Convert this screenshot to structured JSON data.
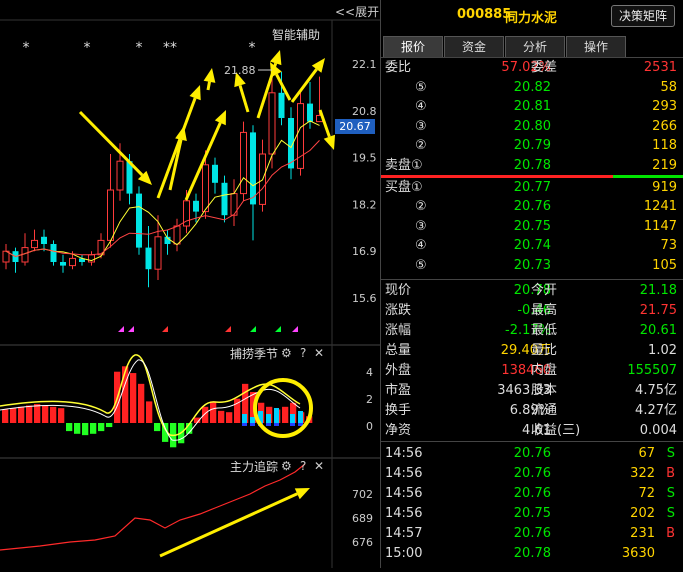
{
  "chart": {
    "toggle_label": "<<展开",
    "indicator_label": "智能辅助",
    "stars": [
      "*",
      "*",
      "*",
      "**",
      "*"
    ],
    "price_axis": [
      "22.1",
      "20.8",
      "19.5",
      "18.2",
      "16.9",
      "15.6"
    ],
    "current_price_tag": "20.67",
    "high_marker": "21.88",
    "mid_panel": {
      "title": "捕捞季节",
      "axis": [
        "4",
        "2",
        "0"
      ]
    },
    "low_panel": {
      "title": "主力追踪",
      "axis": [
        "702",
        "689",
        "676"
      ]
    },
    "settings_icon": "gear-icon",
    "help_glyph": "?",
    "close_glyph": "✕"
  },
  "chart_data": {
    "type": "candlestick",
    "price_axis_ticks": [
      22.1,
      20.8,
      19.5,
      18.2,
      16.9,
      15.6
    ],
    "current_price": 20.67,
    "max_marked": 21.88,
    "candles": [
      {
        "o": 16.6,
        "c": 16.9,
        "h": 17.1,
        "l": 16.4
      },
      {
        "o": 16.9,
        "c": 16.6,
        "h": 17.0,
        "l": 16.3
      },
      {
        "o": 16.6,
        "c": 17.0,
        "h": 17.4,
        "l": 16.5
      },
      {
        "o": 17.0,
        "c": 17.2,
        "h": 17.5,
        "l": 16.9
      },
      {
        "o": 17.3,
        "c": 17.1,
        "h": 17.5,
        "l": 16.9
      },
      {
        "o": 17.1,
        "c": 16.6,
        "h": 17.2,
        "l": 16.5
      },
      {
        "o": 16.6,
        "c": 16.5,
        "h": 16.8,
        "l": 16.3
      },
      {
        "o": 16.5,
        "c": 16.7,
        "h": 16.9,
        "l": 16.4
      },
      {
        "o": 16.7,
        "c": 16.6,
        "h": 16.8,
        "l": 16.5
      },
      {
        "o": 16.6,
        "c": 16.8,
        "h": 16.9,
        "l": 16.5
      },
      {
        "o": 16.8,
        "c": 17.2,
        "h": 17.4,
        "l": 16.7
      },
      {
        "o": 17.2,
        "c": 18.6,
        "h": 19.6,
        "l": 17.0
      },
      {
        "o": 18.6,
        "c": 19.4,
        "h": 19.9,
        "l": 18.3
      },
      {
        "o": 19.4,
        "c": 18.5,
        "h": 19.6,
        "l": 18.2
      },
      {
        "o": 18.5,
        "c": 17.0,
        "h": 18.7,
        "l": 16.8
      },
      {
        "o": 17.0,
        "c": 16.4,
        "h": 17.6,
        "l": 15.9
      },
      {
        "o": 16.4,
        "c": 17.3,
        "h": 17.9,
        "l": 16.1
      },
      {
        "o": 17.3,
        "c": 17.1,
        "h": 17.5,
        "l": 16.8
      },
      {
        "o": 17.1,
        "c": 17.6,
        "h": 17.8,
        "l": 16.9
      },
      {
        "o": 17.6,
        "c": 18.3,
        "h": 18.6,
        "l": 17.4
      },
      {
        "o": 18.3,
        "c": 18.0,
        "h": 18.5,
        "l": 17.7
      },
      {
        "o": 18.0,
        "c": 19.3,
        "h": 19.7,
        "l": 17.8
      },
      {
        "o": 19.3,
        "c": 18.8,
        "h": 19.5,
        "l": 18.5
      },
      {
        "o": 18.8,
        "c": 17.9,
        "h": 19.0,
        "l": 17.7
      },
      {
        "o": 17.9,
        "c": 18.5,
        "h": 18.9,
        "l": 17.6
      },
      {
        "o": 18.5,
        "c": 20.2,
        "h": 20.5,
        "l": 18.3
      },
      {
        "o": 20.2,
        "c": 18.2,
        "h": 20.4,
        "l": 17.2
      },
      {
        "o": 18.2,
        "c": 19.6,
        "h": 20.0,
        "l": 18.0
      },
      {
        "o": 19.6,
        "c": 21.3,
        "h": 21.7,
        "l": 19.2
      },
      {
        "o": 21.3,
        "c": 20.6,
        "h": 21.88,
        "l": 20.4
      },
      {
        "o": 20.6,
        "c": 19.2,
        "h": 20.9,
        "l": 18.9
      },
      {
        "o": 19.2,
        "c": 21.0,
        "h": 21.3,
        "l": 19.0
      },
      {
        "o": 21.0,
        "c": 20.5,
        "h": 21.6,
        "l": 20.3
      },
      {
        "o": 20.5,
        "c": 20.67,
        "h": 21.75,
        "l": 20.61
      }
    ]
  },
  "quote": {
    "code": "000885",
    "name": "同力水泥",
    "decide_button": "决策矩阵",
    "tabs": [
      "报价",
      "资金",
      "分析",
      "操作"
    ],
    "ratio": {
      "label": "委比",
      "value": "57.02%",
      "label2": "委差",
      "value2": "2531"
    },
    "sell": [
      {
        "level": "⑤",
        "price": "20.82",
        "vol": "58"
      },
      {
        "level": "④",
        "price": "20.81",
        "vol": "293"
      },
      {
        "level": "③",
        "price": "20.80",
        "vol": "266"
      },
      {
        "level": "②",
        "price": "20.79",
        "vol": "118"
      },
      {
        "level": "卖盘①",
        "price": "20.78",
        "vol": "219"
      }
    ],
    "buy": [
      {
        "level": "买盘①",
        "price": "20.77",
        "vol": "919"
      },
      {
        "level": "②",
        "price": "20.76",
        "vol": "1241"
      },
      {
        "level": "③",
        "price": "20.75",
        "vol": "1147"
      },
      {
        "level": "④",
        "price": "20.74",
        "vol": "73"
      },
      {
        "level": "⑤",
        "price": "20.73",
        "vol": "105"
      }
    ],
    "stats": [
      {
        "l1": "现价",
        "v1": "20.78",
        "c1": "green",
        "l2": "今开",
        "v2": "21.18",
        "c2": "green"
      },
      {
        "l1": "涨跌",
        "v1": "-0.46",
        "c1": "green",
        "l2": "最高",
        "v2": "21.75",
        "c2": "red"
      },
      {
        "l1": "涨幅",
        "v1": "-2.17%",
        "c1": "green",
        "l2": "最低",
        "v2": "20.61",
        "c2": "green"
      },
      {
        "l1": "总量",
        "v1": "29.40万",
        "c1": "yellow",
        "l2": "量比",
        "v2": "1.02",
        "c2": "white"
      },
      {
        "l1": "外盘",
        "v1": "138460",
        "c1": "red",
        "l2": "内盘",
        "v2": "155507",
        "c2": "green"
      },
      {
        "l1": "市盈",
        "v1": "3463.33",
        "c1": "white",
        "l2": "股本",
        "v2": "4.75亿",
        "c2": "white"
      },
      {
        "l1": "换手",
        "v1": "6.89%",
        "c1": "white",
        "l2": "流通",
        "v2": "4.27亿",
        "c2": "white"
      },
      {
        "l1": "净资",
        "v1": "4.61",
        "c1": "white",
        "l2": "收益(三)",
        "v2": "0.004",
        "c2": "white"
      }
    ],
    "trades": [
      {
        "time": "14:56",
        "price": "20.76",
        "vol": "67",
        "side": "S"
      },
      {
        "time": "14:56",
        "price": "20.76",
        "vol": "322",
        "side": "B"
      },
      {
        "time": "14:56",
        "price": "20.76",
        "vol": "72",
        "side": "S"
      },
      {
        "time": "14:56",
        "price": "20.75",
        "vol": "202",
        "side": "S"
      },
      {
        "time": "14:57",
        "price": "20.76",
        "vol": "231",
        "side": "B"
      },
      {
        "time": "15:00",
        "price": "20.78",
        "vol": "3630",
        "side": ""
      }
    ]
  }
}
